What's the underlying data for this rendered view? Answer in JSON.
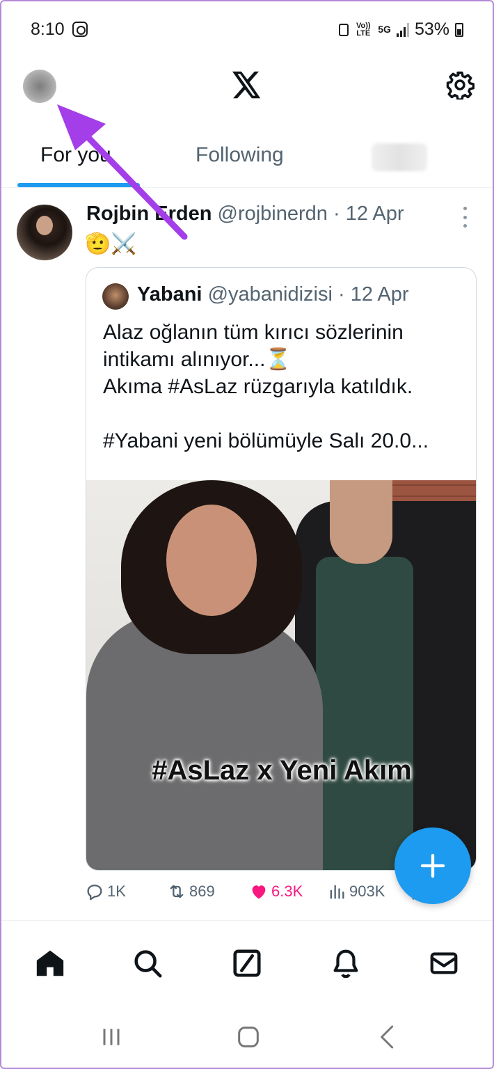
{
  "status_bar": {
    "time": "8:10",
    "network_volte": "Vo)) LTE",
    "network_5g": "5G",
    "battery": "53%"
  },
  "header": {
    "logo": "X",
    "avatar_icon": "profile-avatar",
    "settings_icon": "gear-icon"
  },
  "tabs": [
    {
      "label": "For you",
      "active": true
    },
    {
      "label": "Following",
      "active": false
    }
  ],
  "post": {
    "author_name": "Rojbin Erden",
    "author_handle": "@rojbinerdn",
    "date": "· 12 Apr",
    "text": "🫡⚔️",
    "quote": {
      "author_name": "Yabani",
      "author_handle": "@yabanidizisi",
      "date": "· 12 Apr",
      "text": "Alaz oğlanın tüm kırıcı sözlerinin intikamı alınıyor...⏳\nAkıma #AsLaz rüzgarıyla katıldık.\n\n#Yabani yeni bölümüyle Salı 20.0...",
      "media_caption": "#AsLaz x Yeni Akım"
    },
    "stats": {
      "replies": "1K",
      "reposts": "869",
      "likes": "6.3K",
      "views": "903K"
    }
  },
  "bottom_nav": [
    "home-icon",
    "search-icon",
    "grok-icon",
    "bell-icon",
    "mail-icon"
  ],
  "system_nav": [
    "recents",
    "home",
    "back"
  ],
  "colors": {
    "accent": "#1d9bf0",
    "like": "#f91880",
    "annotation_arrow": "#a43ee8",
    "secondary_text": "#536471"
  }
}
